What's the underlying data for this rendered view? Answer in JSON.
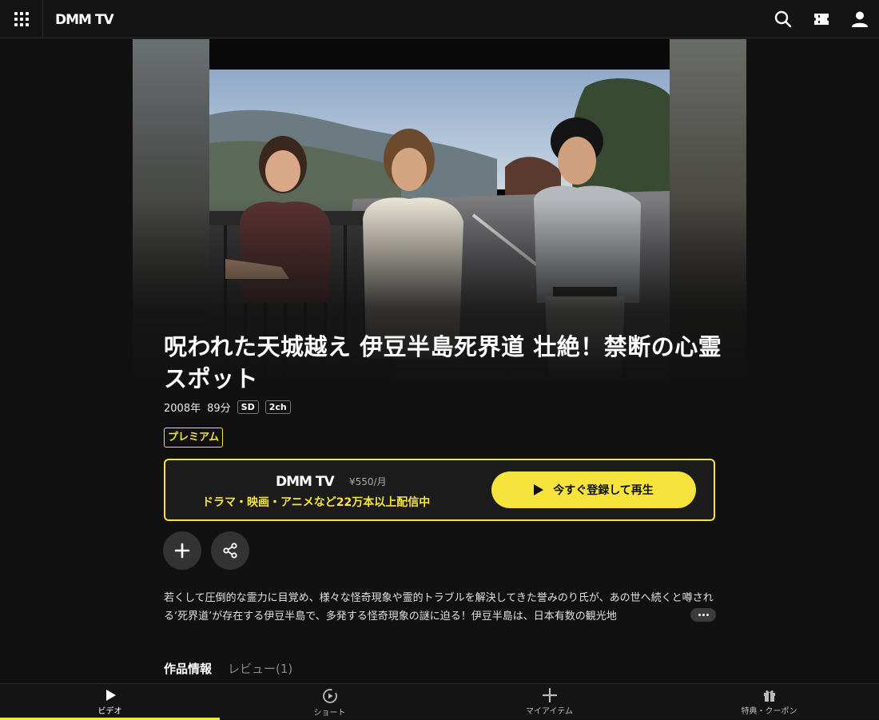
{
  "header": {
    "logo_text": "DMM TV",
    "icons": [
      "grid-menu-icon",
      "search-icon",
      "ticket-icon",
      "user-icon"
    ]
  },
  "title": "呪われた天城越え 伊豆半島死界道 壮絶！禁断の心霊スポット",
  "meta": {
    "year": "2008年",
    "duration": "89分",
    "badges": [
      "SD",
      "2ch"
    ]
  },
  "premium_label": "プレミアム",
  "subscribe": {
    "logo_text": "DMM TV",
    "price": "¥550/月",
    "tagline": "ドラマ・映画・アニメなど22万本以上配信中",
    "button_label": "今すぐ登録して再生"
  },
  "description": "若くして圧倒的な霊力に目覚め、様々な怪奇現象や霊的トラブルを解決してきた誉みのり氏が、あの世へ続くと噂される‘死界道’が存在する伊豆半島で、多発する怪奇現象の謎に迫る！伊豆半島は、日本有数の観光地",
  "tabs": [
    {
      "label": "作品情報"
    },
    {
      "label": "レビュー(1)"
    }
  ],
  "bottom_nav": [
    {
      "label": "ビデオ",
      "icon": "play-icon"
    },
    {
      "label": "ショート",
      "icon": "shorts-icon"
    },
    {
      "label": "マイアイテム",
      "icon": "plus-icon"
    },
    {
      "label": "特典・クーポン",
      "icon": "gift-icon"
    }
  ],
  "colors": {
    "accent": "#f6e33c",
    "background": "#111111"
  }
}
